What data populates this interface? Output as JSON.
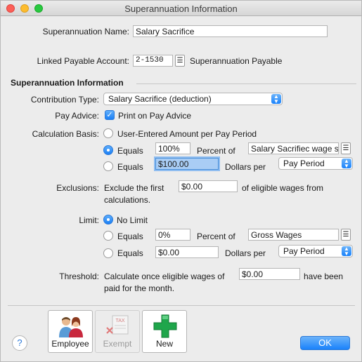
{
  "window": {
    "title": "Superannuation Information"
  },
  "header": {
    "name_label": "Superannuation Name:",
    "name_value": "Salary Sacrifice",
    "linked_label": "Linked Payable Account:",
    "linked_account": "2-1530",
    "linked_account_name": "Superannuation Payable"
  },
  "section": {
    "title": "Superannuation Information"
  },
  "contribution": {
    "label": "Contribution Type:",
    "value": "Salary Sacrifice (deduction)"
  },
  "pay_advice": {
    "label": "Pay Advice:",
    "checkbox_label": "Print on Pay Advice",
    "checked": true
  },
  "calculation": {
    "label": "Calculation Basis:",
    "option_user": "User-Entered Amount per Pay Period",
    "option_percent": "Equals",
    "percent_value": "100%",
    "percent_of_label": "Percent of",
    "percent_of_value": "Salary Sacrifiec wage s",
    "option_dollars": "Equals",
    "dollars_value": "$100.00",
    "dollars_per_label": "Dollars per",
    "dollars_per_value": "Pay Period",
    "selected": "percent"
  },
  "exclusions": {
    "label": "Exclusions:",
    "text_before": "Exclude the first",
    "value": "$0.00",
    "text_after": "of eligible wages from",
    "text_line2": "calculations."
  },
  "limit": {
    "label": "Limit:",
    "option_none": "No Limit",
    "option_percent": "Equals",
    "percent_value": "0%",
    "percent_of_label": "Percent of",
    "percent_of_value": "Gross Wages",
    "option_dollars": "Equals",
    "dollars_value": "$0.00",
    "dollars_per_label": "Dollars per",
    "dollars_per_value": "Pay Period",
    "selected": "none"
  },
  "threshold": {
    "label": "Threshold:",
    "text_before": "Calculate once eligible wages of",
    "value": "$0.00",
    "text_after": "have been",
    "text_line2": "paid for the month."
  },
  "toolbar": {
    "employee_label": "Employee",
    "exempt_label": "Exempt",
    "exempt_icon_text": "TAX",
    "new_label": "New"
  },
  "footer": {
    "help_label": "?",
    "ok_label": "OK"
  },
  "colors": {
    "accent": "#1a82fb",
    "focus": "#a9cdf5",
    "new_plus": "#1fa64b"
  }
}
